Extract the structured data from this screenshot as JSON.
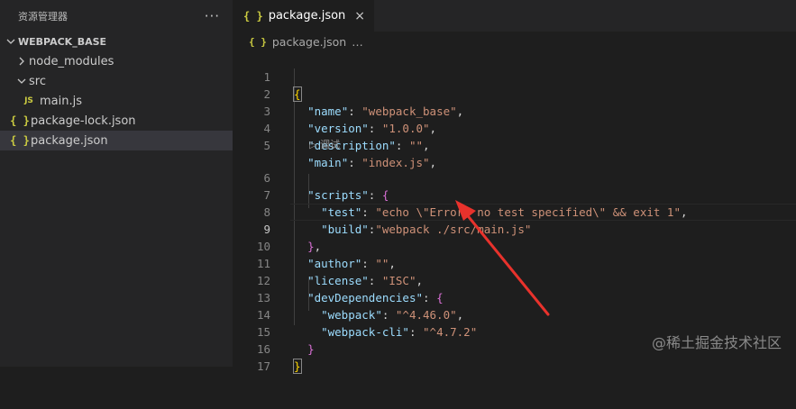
{
  "sidebar": {
    "title": "资源管理器",
    "more": "···",
    "section": "WEBPACK_BASE",
    "items": [
      {
        "label": "node_modules"
      },
      {
        "label": "src"
      },
      {
        "label": "main.js",
        "icon": "JS"
      },
      {
        "label": "package-lock.json",
        "icon": "{ }"
      },
      {
        "label": "package.json",
        "icon": "{ }"
      }
    ]
  },
  "editor": {
    "tab": {
      "label": "package.json",
      "icon": "{ }",
      "close": "×"
    },
    "breadcrumb": {
      "file": "package.json",
      "more": "…"
    },
    "codelens": "▷ 调试",
    "active_line": 9
  },
  "code_lines": [
    {
      "n": "1"
    },
    {
      "n": "2"
    },
    {
      "n": "3"
    },
    {
      "n": "4"
    },
    {
      "n": "5"
    },
    {
      "n": "6"
    },
    {
      "n": "7"
    },
    {
      "n": "8"
    },
    {
      "n": "9"
    },
    {
      "n": "10"
    },
    {
      "n": "11"
    },
    {
      "n": "12"
    },
    {
      "n": "13"
    },
    {
      "n": "14"
    },
    {
      "n": "15"
    },
    {
      "n": "16"
    },
    {
      "n": "17"
    }
  ],
  "code": {
    "l1_open": "{",
    "name_key": "\"name\"",
    "name_val": "\"webpack_base\"",
    "version_key": "\"version\"",
    "version_val": "\"1.0.0\"",
    "description_key": "\"description\"",
    "description_val": "\"\"",
    "main_key": "\"main\"",
    "main_val": "\"index.js\"",
    "scripts_key": "\"scripts\"",
    "scripts_open": "{",
    "test_key": "\"test\"",
    "test_val": "\"echo \\\"Error: no test specified\\\" && exit 1\"",
    "build_key": "\"build\"",
    "build_val": "\"webpack ./src/main.js\"",
    "scripts_close": "}",
    "author_key": "\"author\"",
    "author_val": "\"\"",
    "license_key": "\"license\"",
    "license_val": "\"ISC\"",
    "devdeps_key": "\"devDependencies\"",
    "devdeps_open": "{",
    "webpack_key": "\"webpack\"",
    "webpack_val": "\"^4.46.0\"",
    "webpackcli_key": "\"webpack-cli\"",
    "webpackcli_val": "\"^4.7.2\"",
    "devdeps_close": "}",
    "l16_close": "}"
  },
  "colors": {
    "key": "#9cdcfe",
    "string": "#ce9178",
    "punct": "#d4d4d4",
    "bracket_gold": "#ffd700",
    "bracket_orchid": "#da70d6",
    "arrow": "#e8322c",
    "background": "#1e1e1e",
    "sidebar": "#252526"
  },
  "watermark": "@稀土掘金技术社区"
}
